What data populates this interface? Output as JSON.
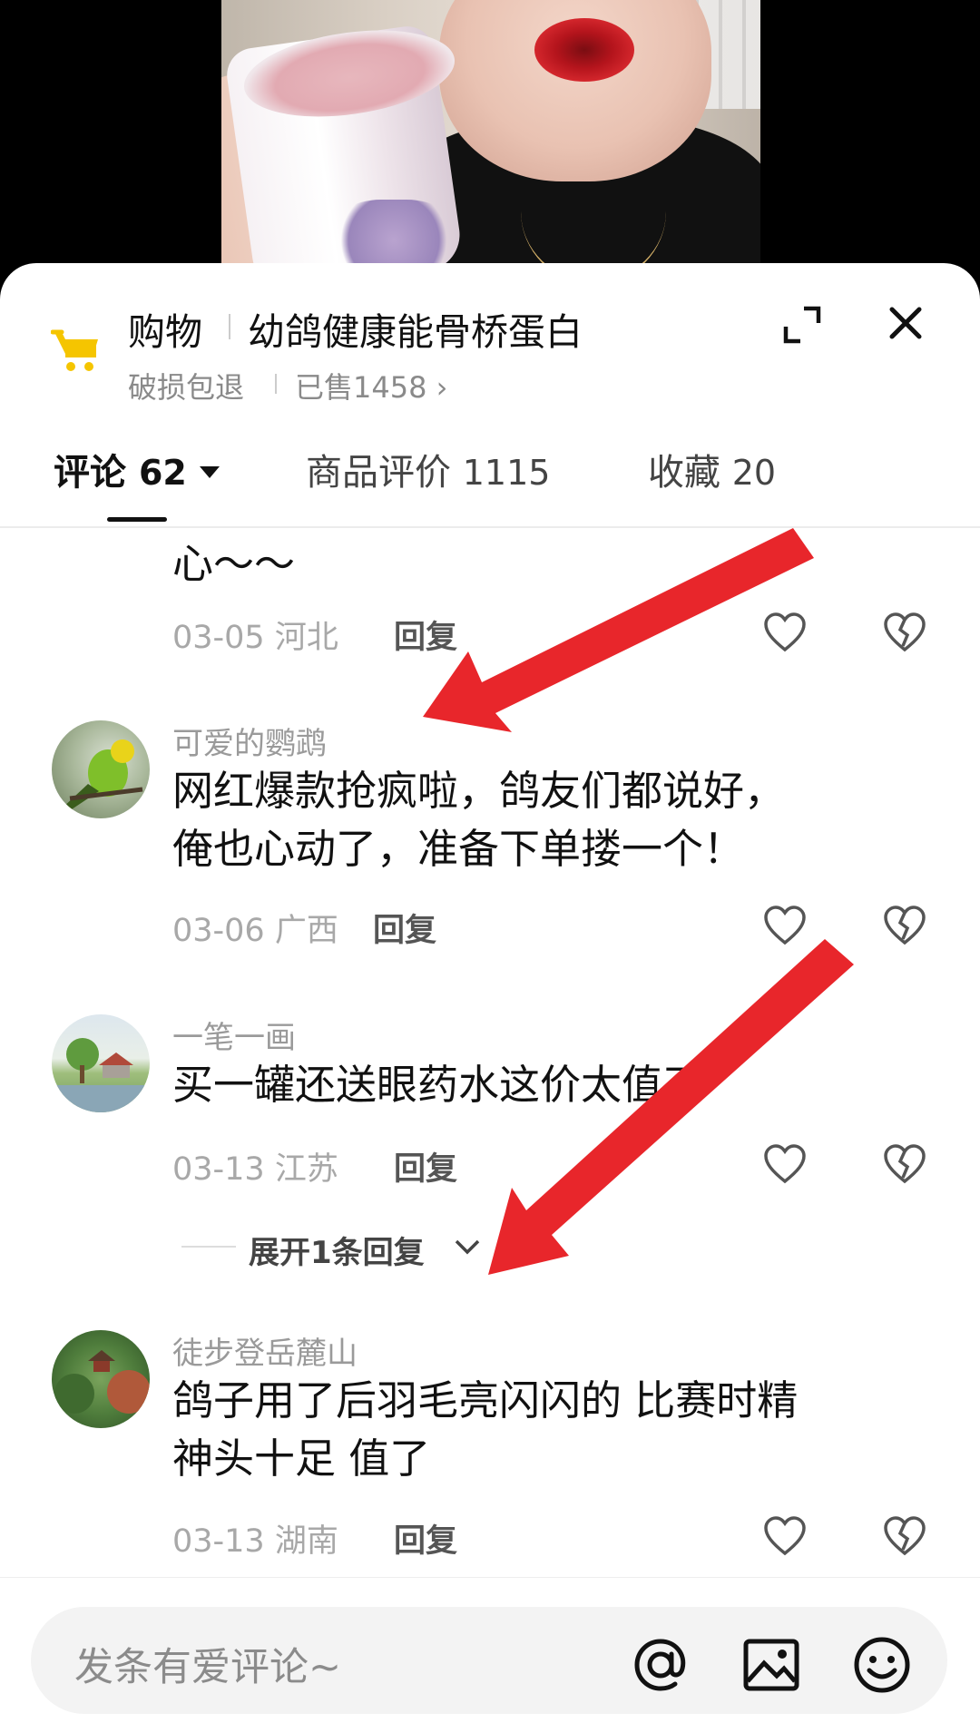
{
  "product": {
    "shop_label": "购物",
    "title": "幼鸽健康能骨桥蛋白",
    "policy": "破损包退",
    "sold": "已售1458",
    "sold_chevron": "›"
  },
  "tabs": [
    {
      "label": "评论",
      "count": "62"
    },
    {
      "label": "商品评价",
      "count": "1115"
    },
    {
      "label": "收藏",
      "count": "20"
    }
  ],
  "comments": [
    {
      "text_lines": [
        "心～～"
      ],
      "date": "03-05",
      "region": "河北",
      "reply": "回复"
    },
    {
      "user": "可爱的鹦鹉",
      "text_lines": [
        "网红爆款抢疯啦，鸽友们都说好，",
        "俺也心动了，准备下单搂一个！"
      ],
      "date": "03-06",
      "region": "广西",
      "reply": "回复"
    },
    {
      "user": "一笔一画",
      "text_lines": [
        "买一罐还送眼药水这价太值了"
      ],
      "date": "03-13",
      "region": "江苏",
      "reply": "回复",
      "expand": "展开1条回复"
    },
    {
      "user": "徒步登岳麓山",
      "text_lines": [
        "鸽子用了后羽毛亮闪闪的 比赛时精",
        "神头十足 值了"
      ],
      "date": "03-13",
      "region": "湖南",
      "reply": "回复"
    }
  ],
  "input": {
    "placeholder": "发条有爱评论~"
  },
  "icons": {
    "cart": "shopping-cart-icon",
    "expand": "expand-icon",
    "close": "close-icon",
    "like": "heart-icon",
    "dislike": "broken-heart-icon",
    "at": "at-icon",
    "image": "image-icon",
    "emoji": "emoji-icon"
  },
  "colors": {
    "accent_cart": "#f5c500",
    "arrow": "#e8262b",
    "text": "#111111",
    "muted": "#a8a8a8"
  }
}
